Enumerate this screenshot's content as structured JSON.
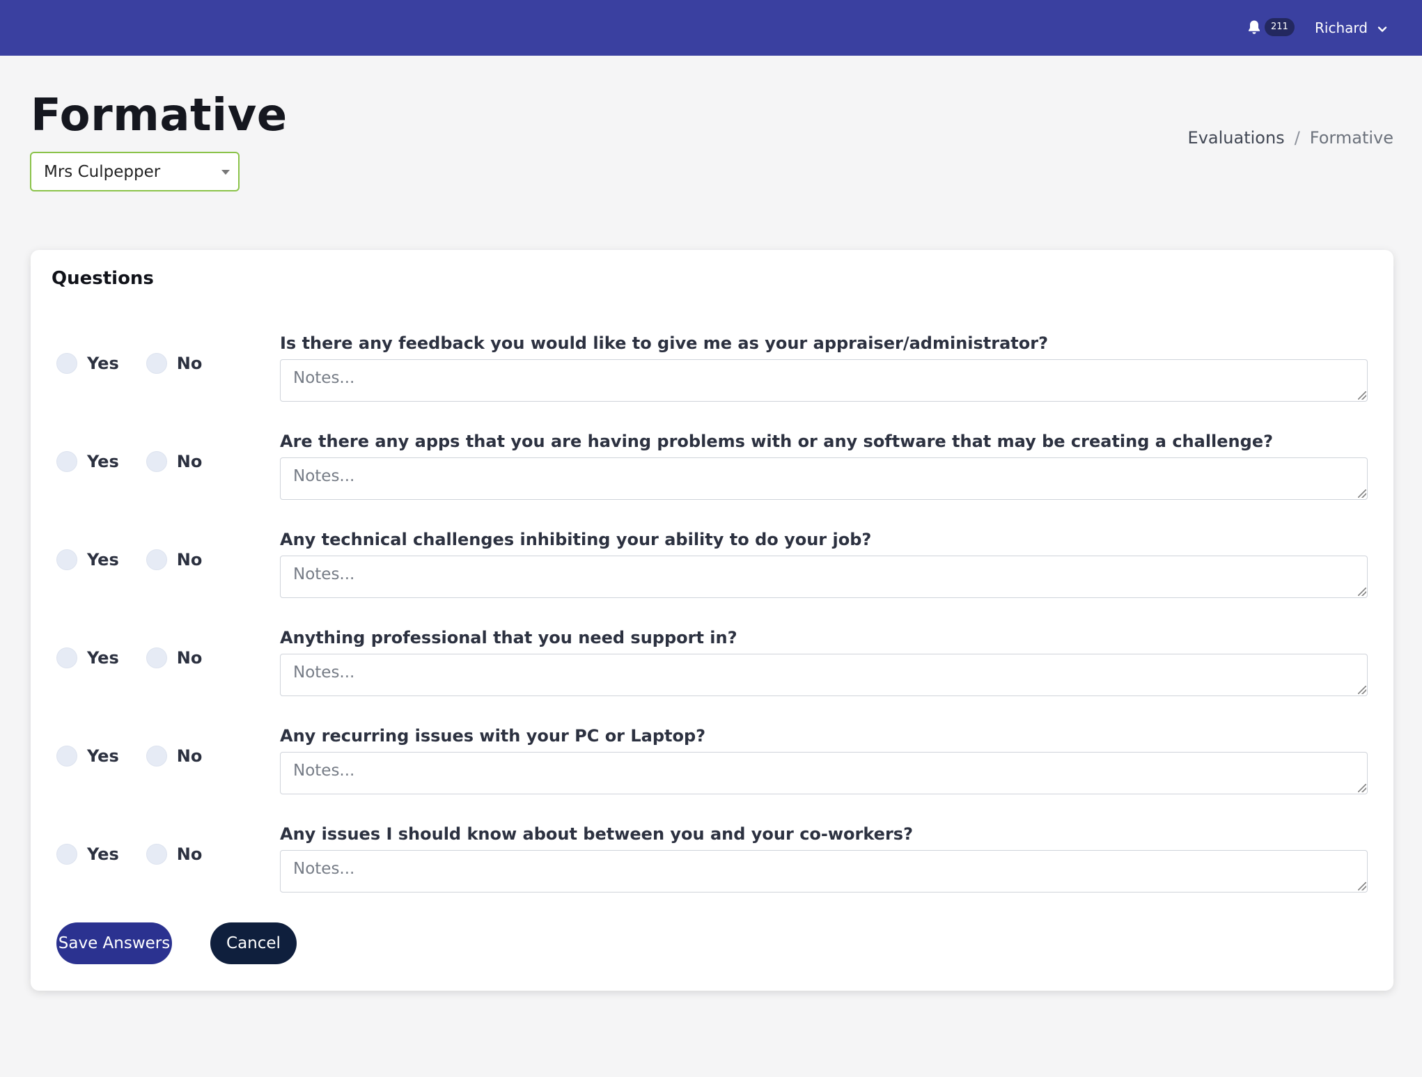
{
  "topbar": {
    "notification_count": "211",
    "user_name": "Richard"
  },
  "page": {
    "title": "Formative",
    "selected_person": "Mrs Culpepper"
  },
  "breadcrumb": {
    "parent": "Evaluations",
    "separator": "/",
    "current": "Formative"
  },
  "card": {
    "title": "Questions",
    "yes_label": "Yes",
    "no_label": "No",
    "notes_placeholder": "Notes...",
    "questions": [
      "Is there any feedback you would like to give me as your appraiser/administrator?",
      "Are there any apps that you are having problems with or any software that may be creating a challenge?",
      "Any technical challenges inhibiting your ability to do your job?",
      "Anything professional that you need support in?",
      "Any recurring issues with your PC or Laptop?",
      "Any issues I should know about between you and your co-workers?"
    ]
  },
  "actions": {
    "save_label": "Save Answers",
    "cancel_label": "Cancel"
  },
  "colors": {
    "topbar": "#3a40a0",
    "save_button": "#2b3290",
    "cancel_button": "#0f1f3d",
    "select_border": "#8bc34a"
  }
}
